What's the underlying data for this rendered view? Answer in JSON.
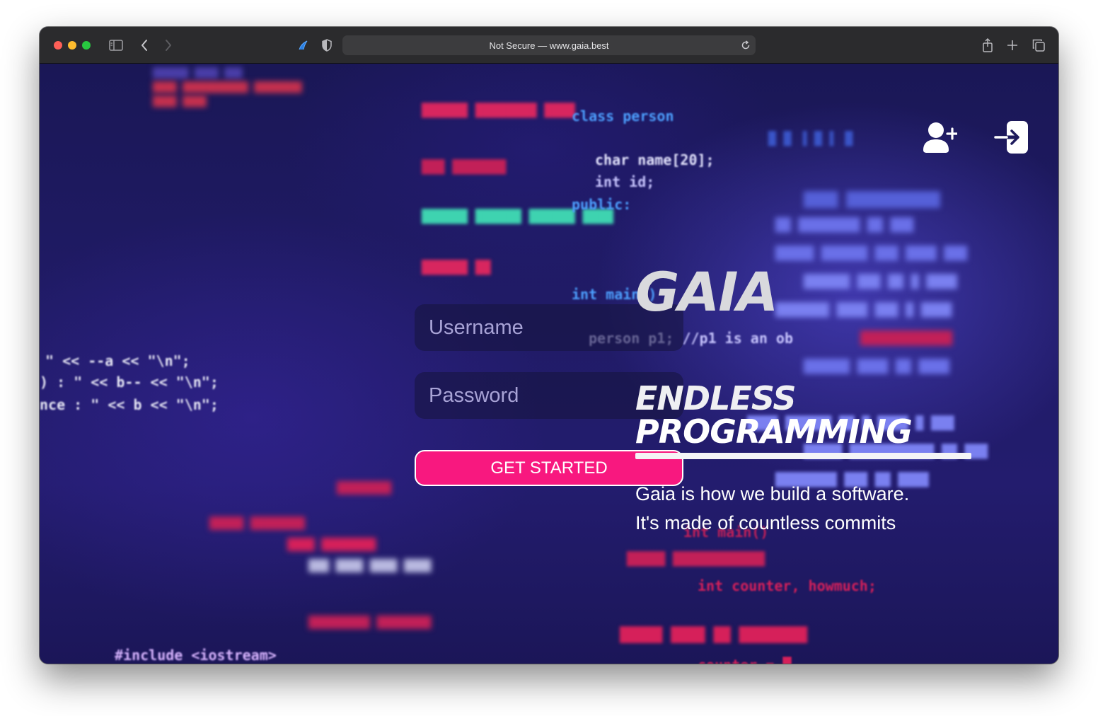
{
  "browser": {
    "address": "Not Secure — www.gaia.best"
  },
  "colors": {
    "accent": "#f8187f",
    "background": "#1d1a5c",
    "text": "#ffffff"
  },
  "header": {
    "register_icon": "user-plus-icon",
    "login_icon": "login-icon"
  },
  "login_form": {
    "username_placeholder": "Username",
    "username_value": "",
    "password_placeholder": "Password",
    "password_value": "",
    "submit_label": "GET STARTED"
  },
  "hero": {
    "brand": "GAIA",
    "headline_line1": "ENDLESS",
    "headline_line2": "PROGRAMMING",
    "tagline_line1": "Gaia is how we build a software.",
    "tagline_line2": "It's made of countless commits"
  },
  "background_code": [
    "class person",
    "char name[20];",
    "int id;",
    "public:",
    "int main()",
    "person p1; //p1 is an ob",
    "\" << --a << \"\\n\";",
    ") : \" << b-- << \"\\n\";",
    "nce : \" << b << \"\\n\";",
    "#include <iostream>",
    "int counter, howmuch;"
  ]
}
